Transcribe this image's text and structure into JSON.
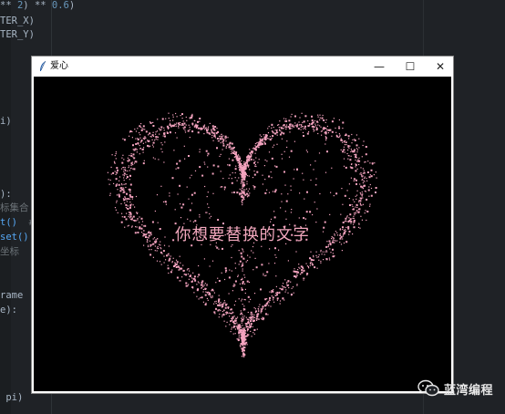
{
  "editor": {
    "lines": [
      {
        "segments": [
          {
            "t": "** ",
            "c": "wave"
          },
          {
            "t": "2",
            "c": "num"
          },
          {
            "t": ") ** ",
            "c": "wave"
          },
          {
            "t": "0.6",
            "c": "num"
          },
          {
            "t": ")",
            "c": "wave"
          }
        ]
      },
      {
        "segments": [
          {
            "t": "TER_X)",
            "c": "wave"
          }
        ]
      },
      {
        "segments": [
          {
            "t": "TER_Y)",
            "c": "wave"
          }
        ]
      },
      {
        "segments": [
          {
            "t": "i)",
            "c": "wave"
          }
        ]
      },
      {
        "segments": [
          {
            "t": "):",
            "c": "wave"
          }
        ]
      },
      {
        "segments": [
          {
            "t": "标集合",
            "c": "muted"
          }
        ]
      },
      {
        "segments": [
          {
            "t": "t()",
            "c": "fn"
          },
          {
            "t": "  #",
            "c": "muted"
          }
        ]
      },
      {
        "segments": [
          {
            "t": "set()",
            "c": "fn"
          }
        ]
      },
      {
        "segments": [
          {
            "t": "坐标",
            "c": "muted"
          }
        ]
      },
      {
        "segments": [
          {
            "t": "rame",
            "c": "wave"
          }
        ]
      },
      {
        "segments": [
          {
            "t": "e):",
            "c": "wave"
          }
        ]
      },
      {
        "segments": [
          {
            "t": " pi)",
            "c": "wave"
          }
        ]
      }
    ]
  },
  "window": {
    "title": "爱心",
    "minimize_glyph": "—",
    "maximize_glyph": "☐",
    "close_glyph": "✕"
  },
  "canvas": {
    "background": "#000000",
    "heart_color": "#f4a3bf",
    "text": "你想要替换的文字",
    "text_color": "#f2a7bd"
  },
  "watermark": {
    "text": "蓝湾编程",
    "icon": "wechat-icon"
  }
}
